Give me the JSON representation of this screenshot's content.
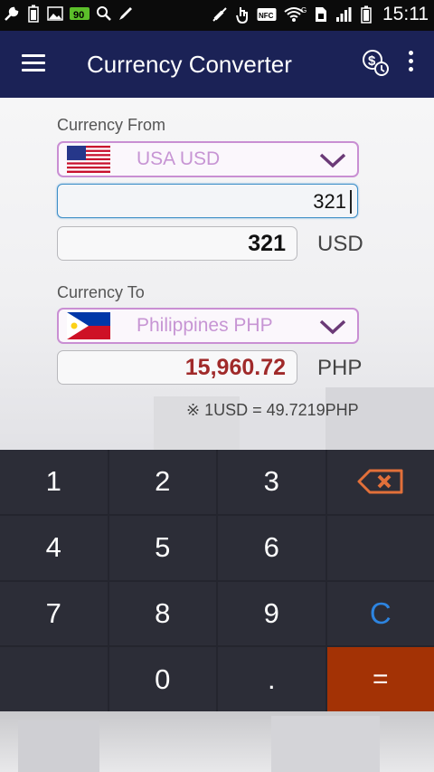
{
  "status_bar": {
    "time": "15:11",
    "left_icons": [
      "wrench-icon",
      "battery-icon",
      "image-icon",
      "battery-level-icon",
      "search-icon",
      "pen-icon"
    ],
    "right_icons": [
      "mute-icon",
      "touch-icon",
      "nfc-icon",
      "wifi-icon",
      "sim-icon",
      "signal-icon",
      "battery-icon"
    ],
    "nfc_label": "NFC"
  },
  "app_bar": {
    "title": "Currency Converter"
  },
  "from": {
    "label": "Currency From",
    "selected": "USA USD",
    "input_value": "321",
    "result_value": "321",
    "code": "USD"
  },
  "to": {
    "label": "Currency To",
    "selected": "Philippines PHP",
    "result_value": "15,960.72",
    "code": "PHP"
  },
  "rate_text": "※ 1USD = 49.7219PHP",
  "keypad": {
    "k1": "1",
    "k2": "2",
    "k3": "3",
    "k4": "4",
    "k5": "5",
    "k6": "6",
    "k7": "7",
    "k8": "8",
    "k9": "9",
    "k0": "0",
    "dot": ".",
    "clear": "C",
    "equals": "="
  },
  "colors": {
    "app_bar": "#1b2256",
    "select_border": "#c98fd3",
    "select_text": "#c795d4",
    "result_to": "#a02a2a",
    "clear_key": "#2d84e0",
    "equals_key": "#a33205",
    "backspace": "#e2703a"
  }
}
